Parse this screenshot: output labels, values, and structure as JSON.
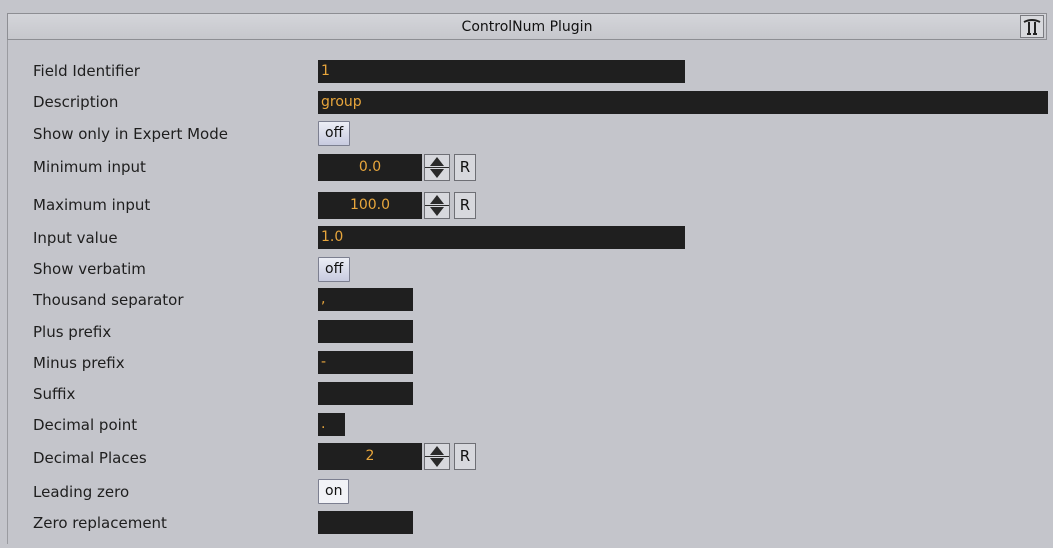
{
  "window": {
    "title": "ControlNum Plugin",
    "icon": "plugin-logo-icon"
  },
  "fields": {
    "field_identifier": {
      "label": "Field Identifier",
      "value": "1"
    },
    "description": {
      "label": "Description",
      "value": "group"
    },
    "expert_mode": {
      "label": "Show only in Expert Mode",
      "value": "off"
    },
    "minimum_input": {
      "label": "Minimum input",
      "value": "0.0",
      "reset": "R"
    },
    "maximum_input": {
      "label": "Maximum input",
      "value": "100.0",
      "reset": "R"
    },
    "input_value": {
      "label": "Input value",
      "value": "1.0"
    },
    "show_verbatim": {
      "label": "Show verbatim",
      "value": "off"
    },
    "thousand_separator": {
      "label": "Thousand separator",
      "value": ","
    },
    "plus_prefix": {
      "label": "Plus prefix",
      "value": ""
    },
    "minus_prefix": {
      "label": "Minus prefix",
      "value": "-"
    },
    "suffix": {
      "label": "Suffix",
      "value": ""
    },
    "decimal_point": {
      "label": "Decimal point",
      "value": "."
    },
    "decimal_places": {
      "label": "Decimal Places",
      "value": "2",
      "reset": "R"
    },
    "leading_zero": {
      "label": "Leading zero",
      "value": "on"
    },
    "zero_replacement": {
      "label": "Zero replacement",
      "value": ""
    }
  },
  "colors": {
    "panel_bg": "#c4c5cb",
    "field_bg": "#1f1f1f",
    "field_text": "#e8a63c"
  }
}
